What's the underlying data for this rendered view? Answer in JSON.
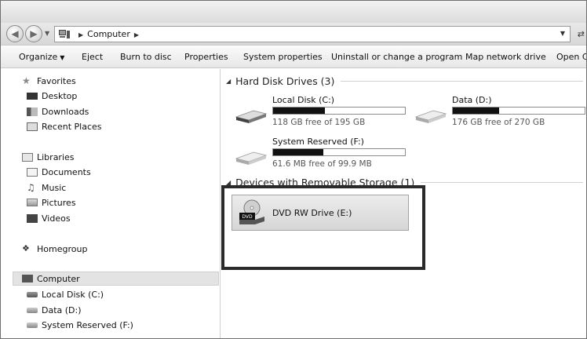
{
  "address": {
    "crumbs": [
      "Computer"
    ],
    "icons": {
      "back": "back-arrow-icon",
      "forward": "forward-arrow-icon",
      "refresh": "refresh-icon"
    }
  },
  "commands": [
    "Organize",
    "Eject",
    "Burn to disc",
    "Properties",
    "System properties",
    "Uninstall or change a program",
    "Map network drive",
    "Open Co"
  ],
  "nav": {
    "favorites": {
      "label": "Favorites",
      "items": [
        "Desktop",
        "Downloads",
        "Recent Places"
      ]
    },
    "libraries": {
      "label": "Libraries",
      "items": [
        "Documents",
        "Music",
        "Pictures",
        "Videos"
      ]
    },
    "homegroup": "Homegroup",
    "computer": {
      "label": "Computer",
      "items": [
        "Local Disk (C:)",
        "Data (D:)",
        "System Reserved (F:)"
      ]
    }
  },
  "groups": {
    "hdd": "Hard Disk Drives (3)",
    "removable": "Devices with Removable Storage (1)"
  },
  "drives": [
    {
      "name": "Local Disk (C:)",
      "free": "118 GB free of 195 GB",
      "used_fraction": 0.39
    },
    {
      "name": "Data (D:)",
      "free": "176 GB free of 270 GB",
      "used_fraction": 0.35
    },
    {
      "name": "System Reserved (F:)",
      "free": "61.6 MB free of 99.9 MB",
      "used_fraction": 0.38
    }
  ],
  "dvd": {
    "name": "DVD RW Drive (E:)",
    "icon_text": "DVD"
  }
}
